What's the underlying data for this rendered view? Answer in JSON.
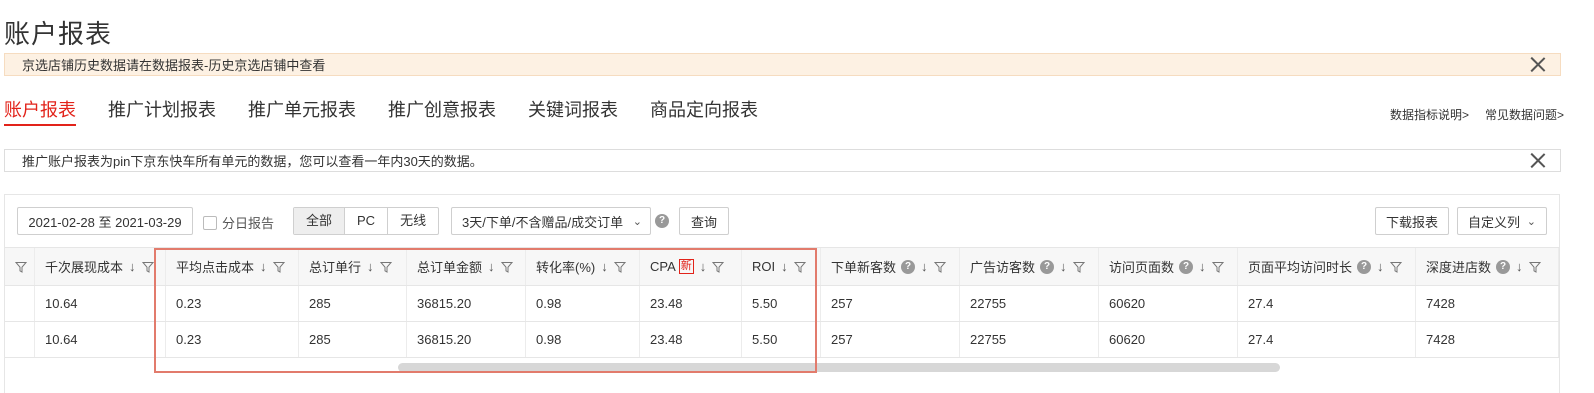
{
  "page": {
    "title": "账户报表"
  },
  "notices": {
    "history": "京选店铺历史数据请在数据报表-历史京选店铺中查看",
    "info": "推广账户报表为pin下京东快车所有单元的数据，您可以查看一年内30天的数据。"
  },
  "tabs": [
    {
      "label": "账户报表",
      "active": true
    },
    {
      "label": "推广计划报表",
      "active": false
    },
    {
      "label": "推广单元报表",
      "active": false
    },
    {
      "label": "推广创意报表",
      "active": false
    },
    {
      "label": "关键词报表",
      "active": false
    },
    {
      "label": "商品定向报表",
      "active": false
    }
  ],
  "help_links": {
    "metrics": "数据指标说明>",
    "faq": "常见数据问题>"
  },
  "toolbar": {
    "date_range": "2021-02-28 至 2021-03-29",
    "daily_report": "分日报告",
    "segments": [
      "全部",
      "PC",
      "无线"
    ],
    "active_segment": "全部",
    "order_type": "3天/下单/不含赠品/成交订单",
    "query": "查询",
    "download": "下载报表",
    "custom_columns": "自定义列"
  },
  "table": {
    "columns": [
      "千次展现成本",
      "平均点击成本",
      "总订单行",
      "总订单金额",
      "转化率(%)",
      "CPA",
      "ROI",
      "下单新客数",
      "广告访客数",
      "访问页面数",
      "页面平均访问时长",
      "深度进店数"
    ],
    "cpa_badge": "新",
    "rows": [
      [
        "10.64",
        "0.23",
        "285",
        "36815.20",
        "0.98",
        "23.48",
        "5.50",
        "257",
        "22755",
        "60620",
        "27.4",
        "7428"
      ],
      [
        "10.64",
        "0.23",
        "285",
        "36815.20",
        "0.98",
        "23.48",
        "5.50",
        "257",
        "22755",
        "60620",
        "27.4",
        "7428"
      ]
    ]
  },
  "colors": {
    "accent": "#e2231a",
    "highlight_border": "#e27b6c",
    "notice_bg": "#fdf1e3"
  }
}
